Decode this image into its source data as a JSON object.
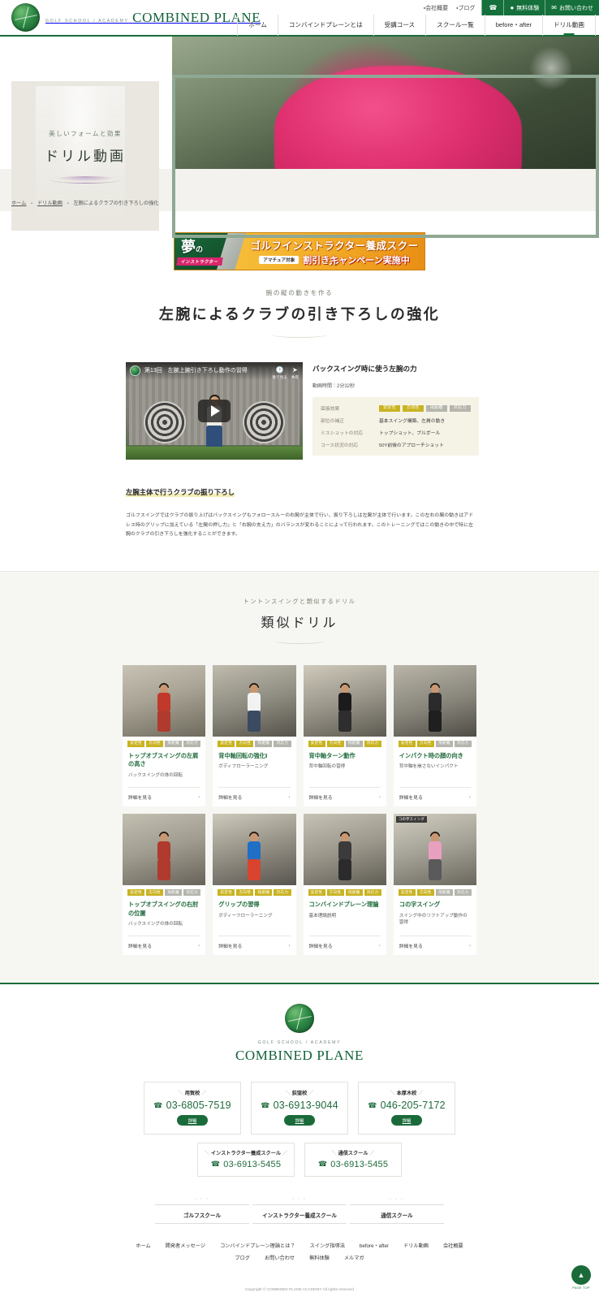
{
  "header": {
    "logo": {
      "tagline": "GOLF SCHOOL / ACADEMY",
      "name": "COMBINED PLANE",
      "icon": "cp-emblem-icon"
    },
    "utility_links": [
      {
        "label": "会社概要"
      },
      {
        "label": "ブログ"
      }
    ],
    "utility_buttons": [
      {
        "label": "",
        "icon": "phone-icon"
      },
      {
        "label": "無料体験",
        "icon": "pin-icon"
      },
      {
        "label": "お問い合わせ",
        "icon": "mail-icon"
      }
    ],
    "nav": [
      {
        "label": "ホーム",
        "active": false
      },
      {
        "label": "コンバインドプレーンとは",
        "active": false
      },
      {
        "label": "受講コース",
        "active": false
      },
      {
        "label": "スクール一覧",
        "active": false
      },
      {
        "label": "before・after",
        "active": false
      },
      {
        "label": "ドリル動画",
        "active": true
      }
    ]
  },
  "hero": {
    "card_sub": "美しいフォームと効果",
    "card_title": "ドリル動画",
    "breadcrumb": [
      {
        "label": "ホーム"
      },
      {
        "label": "ドリル動画"
      },
      {
        "label": "左腕によるクラブの引き下ろしの強化"
      }
    ]
  },
  "banner": {
    "yume_main": "夢",
    "yume_sub": "の",
    "instructor": "インストラクター",
    "headline": "ゴルフインストラクター養成スクール",
    "tag": "アマチュア対象",
    "campaign": "割引きキャンペーン実施中"
  },
  "page_title": {
    "sub": "腕の縦の動きを作る",
    "title": "左腕によるクラブの引き下ろしの強化"
  },
  "video": {
    "player_title": "第13回　左腕上腕引き下ろし動作の習得",
    "action_watch_later": "後で見る",
    "action_share": "共有",
    "meta_title": "バックスイング時に使う左腕の力",
    "duration_label": "動画時間：2分32秒",
    "table": [
      {
        "label": "直接効果",
        "type": "tags",
        "tags": [
          {
            "label": "安定性",
            "on": true
          },
          {
            "label": "方向性",
            "on": true
          },
          {
            "label": "飛距離",
            "on": false
          },
          {
            "label": "対応力",
            "on": false
          }
        ]
      },
      {
        "label": "部位の補正",
        "type": "text",
        "value": "基本スイング構築、左肩の動き"
      },
      {
        "label": "ミスショットの対応",
        "type": "text",
        "value": "トップショット、プルボール"
      },
      {
        "label": "コース状況の対応",
        "type": "text",
        "value": "50Y前後のアプローチショット"
      }
    ]
  },
  "article": {
    "heading": "左腕主体で行うクラブの振り下ろし",
    "body": "ゴルフスイングではクラブの振り上げはバックスイングもフォロースルーの右腕が主体で行い、振り下ろしは左腕が主体で行います。この左右の腕の動きはアドレス時のグリップに加えている「左腕の押し力」と「右腕の支え力」のバランスが変わることによって行われます。このトレーニングではこの動きの中で特に左腕のクラブの引き下ろしを強化することができます。"
  },
  "similar": {
    "sub": "トントンスイングと類似するドリル",
    "title": "類似ドリル",
    "more_label": "詳細を見る",
    "tag_names": [
      "安定性",
      "方向性",
      "飛距離",
      "対応力"
    ],
    "cards": [
      {
        "title": "トップオブスイングの左肩の高さ",
        "desc": "バックスイングの体の回転",
        "tags": [
          true,
          true,
          false,
          false
        ],
        "thumb": "ct-a",
        "badge": ""
      },
      {
        "title": "背中軸回転の強化Ⅰ",
        "desc": "ボディフローラーニング",
        "tags": [
          true,
          true,
          false,
          false
        ],
        "thumb": "ct-b",
        "badge": ""
      },
      {
        "title": "背中軸ターン動作",
        "desc": "背中軸回転の習得",
        "tags": [
          true,
          true,
          false,
          true
        ],
        "thumb": "ct-c",
        "badge": ""
      },
      {
        "title": "インパクト時の顔の向き",
        "desc": "背中軸を崩さないインパクト",
        "tags": [
          true,
          true,
          false,
          false
        ],
        "thumb": "ct-d",
        "badge": ""
      },
      {
        "title": "トップオブスイングの右肘の位置",
        "desc": "バックスイングの体の回転",
        "tags": [
          true,
          true,
          false,
          false
        ],
        "thumb": "ct-e",
        "badge": ""
      },
      {
        "title": "グリップの習得",
        "desc": "ボディーフローラーニング",
        "tags": [
          true,
          true,
          true,
          true
        ],
        "thumb": "ct-f",
        "badge": ""
      },
      {
        "title": "コンバインドプレーン理論",
        "desc": "基本理論説明",
        "tags": [
          true,
          true,
          true,
          true
        ],
        "thumb": "ct-g",
        "badge": ""
      },
      {
        "title": "コの字スイング",
        "desc": "スイング中のリフトアップ動作の習得",
        "tags": [
          true,
          true,
          false,
          false
        ],
        "thumb": "ct-h",
        "badge": "コの字スイング"
      }
    ]
  },
  "footer": {
    "logo": {
      "tagline": "GOLF SCHOOL / ACADEMY",
      "name": "COMBINED PLANE",
      "icon": "cp-emblem-icon"
    },
    "detail_label": "詳細",
    "schools": [
      {
        "name": "用賀校",
        "phone": "03-6805-7519"
      },
      {
        "name": "荻窪校",
        "phone": "03-6913-9044"
      },
      {
        "name": "本厚木校",
        "phone": "046-205-7172"
      }
    ],
    "schools2": [
      {
        "name": "インストラクター養成スクール",
        "phone": "03-6913-5455"
      },
      {
        "name": "通信スクール",
        "phone": "03-6913-5455"
      }
    ],
    "categories": [
      {
        "label": "ゴルフスクール"
      },
      {
        "label": "インストラクター養成スクール"
      },
      {
        "label": "通信スクール"
      }
    ],
    "links": [
      {
        "label": "ホーム"
      },
      {
        "label": "開発者メッセージ"
      },
      {
        "label": "コンバインドプレーン理論とは？"
      },
      {
        "label": "スイング指導法"
      },
      {
        "label": "before・after"
      },
      {
        "label": "ドリル動画"
      },
      {
        "label": "会社概要"
      },
      {
        "label": "ブログ"
      },
      {
        "label": "お問い合わせ"
      },
      {
        "label": "無料体験"
      },
      {
        "label": "メルマガ"
      }
    ],
    "copyright": "Copyright © COMBINED PLANE ACADEMY All rights reserved",
    "pagetop": "PAGE TOP"
  },
  "colors": {
    "brand_green": "#1b6b3a",
    "accent_gold": "#c9b321",
    "tag_off": "#b5b5ad",
    "banner_orange": "#f4b02a",
    "link_green": "#1f6b3c"
  }
}
